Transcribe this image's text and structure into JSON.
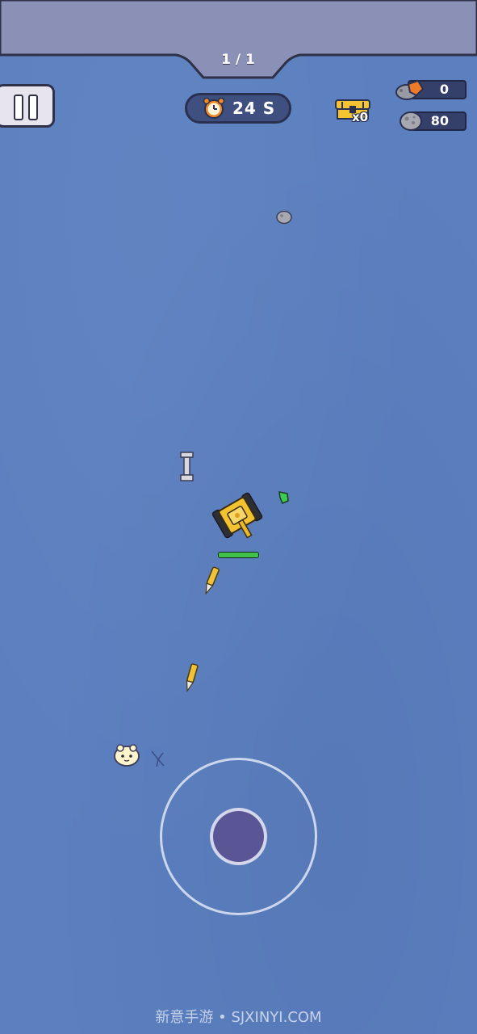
{
  "hud": {
    "wave": "1 / 1",
    "timer": "24 S",
    "chest_count": "x0",
    "ore_count": "0",
    "stone_count": "80"
  },
  "player": {
    "health_fraction": 1.0
  },
  "watermark": "新意手游 • SJXINYI.COM",
  "colors": {
    "background": "#5b7fbf",
    "banner": "#8a8fb5",
    "tank_body": "#f2c230",
    "health": "#3fc14a",
    "joystick_knob": "#5a5696"
  },
  "icons": {
    "pause": "pause-icon",
    "timer": "alarm-clock-icon",
    "chest": "treasure-chest-icon",
    "ore": "copper-ore-icon",
    "stone": "stone-icon"
  }
}
